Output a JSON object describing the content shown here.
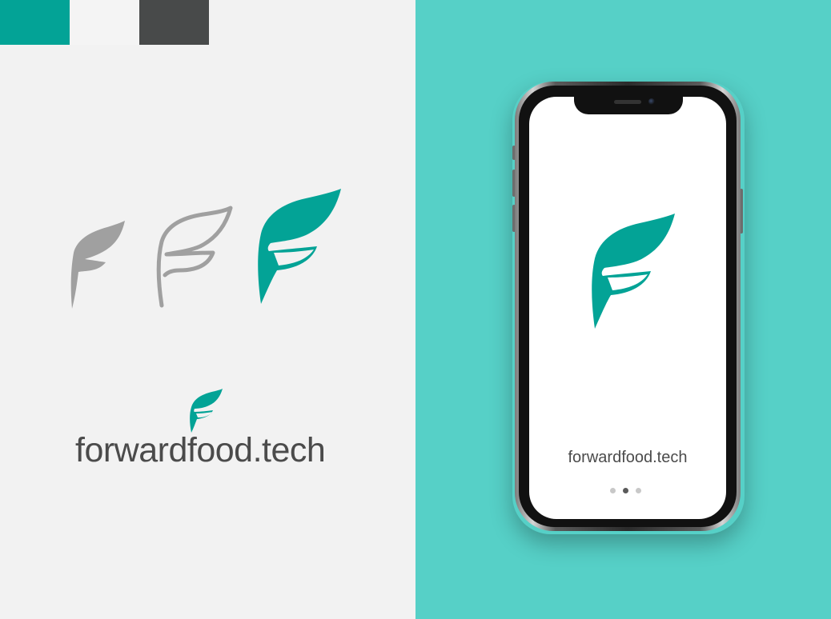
{
  "colors": {
    "teal": "#03a396",
    "light_gray": "#f2f2f2",
    "dark_gray": "#484a4a",
    "mid_gray": "#a0a0a0",
    "screen_bg": "#ffffff",
    "panel_teal": "#56d0c7",
    "wordmark_text": "#4b4b4b"
  },
  "palette": {
    "swatches": [
      {
        "name": "teal",
        "color": "#03a396"
      },
      {
        "name": "light-gray",
        "color": "#f4f4f4"
      },
      {
        "name": "dark-gray",
        "color": "#484a4a"
      }
    ]
  },
  "logo_variants": [
    {
      "style": "solid-gray",
      "icon": "leaf-f-icon"
    },
    {
      "style": "outline-gray",
      "icon": "leaf-f-icon"
    },
    {
      "style": "teal",
      "icon": "leaf-f-icon"
    }
  ],
  "brand": {
    "wordmark": "forwardfood.tech",
    "icon": "leaf-f-icon"
  },
  "phone": {
    "screen": {
      "logo_icon": "leaf-f-icon",
      "wordmark": "forwardfood.tech",
      "pager": {
        "total": 3,
        "active": 2
      }
    }
  }
}
